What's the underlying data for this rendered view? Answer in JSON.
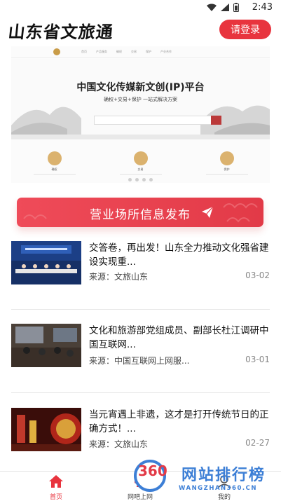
{
  "status_bar": {
    "time": "2:43"
  },
  "header": {
    "title": "山东省文旅通",
    "login_label": "请登录"
  },
  "banner": {
    "nav_items": [
      "首页",
      "产品服务",
      "确权",
      "交易",
      "保护",
      "产业合作"
    ],
    "headline": "中国文化传媒新文创(IP)平台",
    "subheadline": "确权+交易+保护 一站式解决方案",
    "features": [
      "确权",
      "交易",
      "保护"
    ]
  },
  "promo": {
    "label": "营业场所信息发布"
  },
  "news": [
    {
      "title": "交答卷，再出发！山东全力推动文化强省建设实现重...",
      "source": "来源：文旅山东",
      "date": "03-02"
    },
    {
      "title": "文化和旅游部党组成员、副部长杜江调研中国互联网...",
      "source": "来源：中国互联网上网服...",
      "date": "03-01"
    },
    {
      "title": "当元宵遇上非遗，这才是打开传统节日的正确方式！...",
      "source": "来源：文旅山东",
      "date": "02-27"
    }
  ],
  "tabbar": {
    "tabs": [
      "首页",
      "网吧上网",
      "我的"
    ]
  },
  "watermark": {
    "number": "360",
    "text": "网站排行榜",
    "url": "WANGZHAN360.CN"
  },
  "colors": {
    "accent": "#e8343e",
    "watermark_blue": "#3d7fd6"
  }
}
